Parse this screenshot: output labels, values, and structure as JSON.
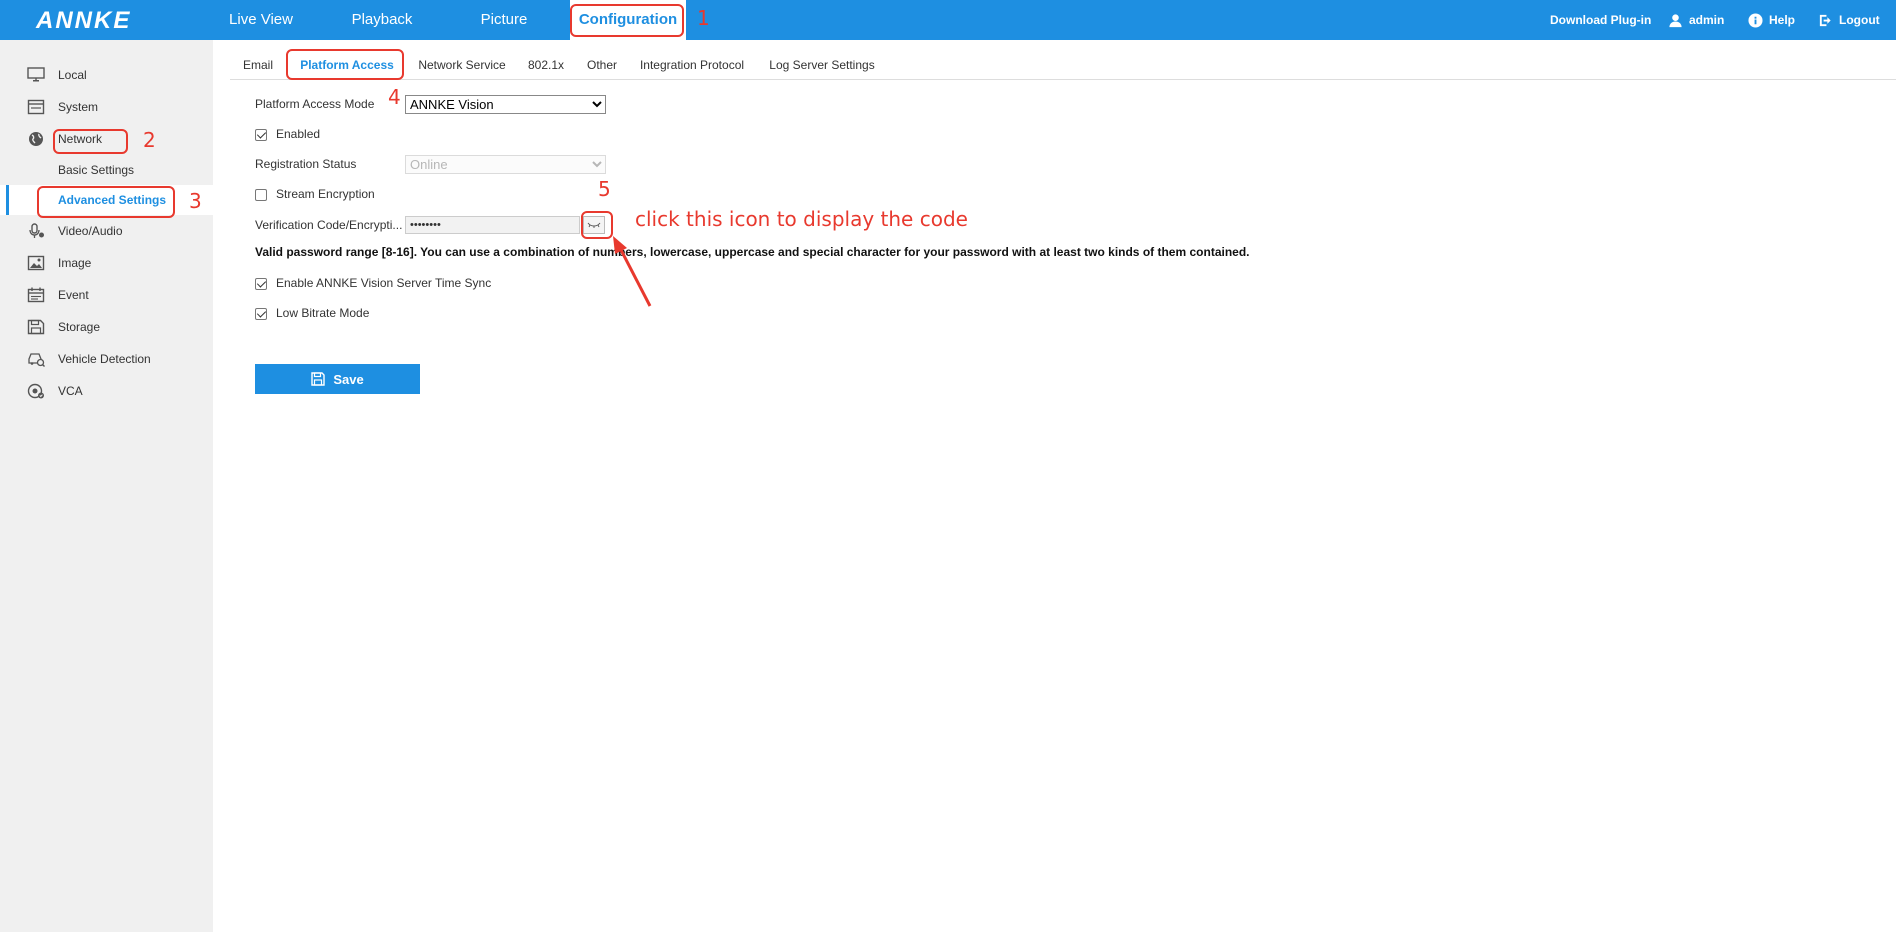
{
  "header": {
    "logo": "ANNKE",
    "nav": [
      "Live View",
      "Playback",
      "Picture",
      "Configuration"
    ],
    "download_plugin": "Download Plug-in",
    "user": "admin",
    "help": "Help",
    "logout": "Logout"
  },
  "sidebar": {
    "items": {
      "local": "Local",
      "system": "System",
      "network": "Network",
      "basic_settings": "Basic Settings",
      "advanced_settings": "Advanced Settings",
      "video_audio": "Video/Audio",
      "image": "Image",
      "event": "Event",
      "storage": "Storage",
      "vehicle_detection": "Vehicle Detection",
      "vca": "VCA"
    }
  },
  "tabs": [
    "Email",
    "Platform Access",
    "Network Service",
    "802.1x",
    "Other",
    "Integration Protocol",
    "Log Server Settings"
  ],
  "form": {
    "platform_access_mode_label": "Platform Access Mode",
    "platform_access_mode_value": "ANNKE Vision",
    "enabled_label": "Enabled",
    "enabled_checked": true,
    "registration_status_label": "Registration Status",
    "registration_status_value": "Online",
    "stream_encryption_label": "Stream Encryption",
    "stream_encryption_checked": false,
    "verification_code_label": "Verification Code/Encrypti...",
    "verification_code_value": "••••••••",
    "password_hint": "Valid password range [8-16]. You can use a combination of numbers, lowercase, uppercase and special character for your password with at least two kinds of them contained.",
    "time_sync_label": "Enable ANNKE Vision Server Time Sync",
    "time_sync_checked": true,
    "low_bitrate_label": "Low Bitrate Mode",
    "low_bitrate_checked": true,
    "save_label": "Save"
  },
  "annotations": {
    "n1": "1",
    "n2": "2",
    "n3": "3",
    "n4": "4",
    "n5": "5",
    "instruction": "click this icon to display the code"
  },
  "colors": {
    "brand": "#1e8fe1",
    "annotation": "#e8392e",
    "sidebar_bg": "#f0f0f0"
  }
}
